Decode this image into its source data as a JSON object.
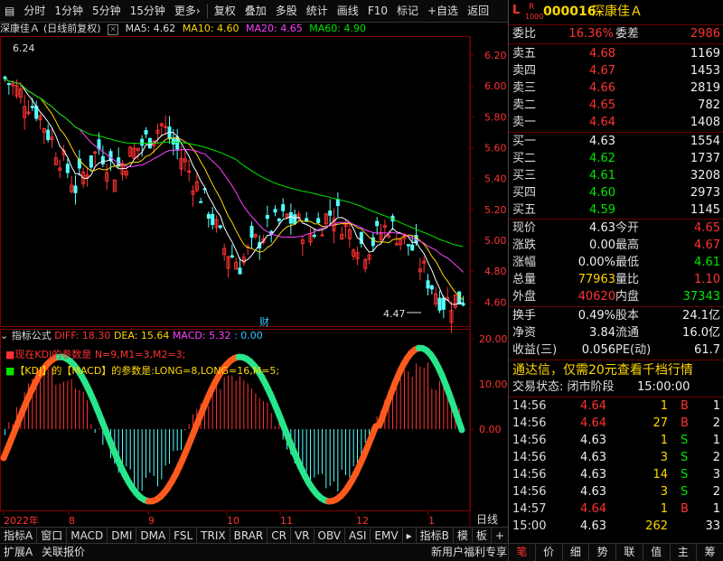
{
  "toolbar": {
    "items": [
      "分时",
      "1分钟",
      "5分钟",
      "15分钟",
      "更多›",
      "复权",
      "叠加",
      "多股",
      "统计",
      "画线",
      "F10",
      "标记",
      "+自选",
      "返回"
    ]
  },
  "chart": {
    "stock_title": "深康佳Ａ",
    "mode": "(日线前复权)",
    "ma5": "MA5: 4.62",
    "ma10": "MA10: 4.60",
    "ma20": "MA20: 4.65",
    "ma60": "MA60: 4.90",
    "high_label": "6.24",
    "low_label": "4.47",
    "cai_label": "财",
    "price_ticks": [
      "6.20",
      "6.00",
      "5.80",
      "5.60",
      "5.40",
      "5.20",
      "5.00",
      "4.80",
      "4.60"
    ],
    "indicator_title": "指标公式",
    "diff": "DIFF: 18.30",
    "dea": "DEA: 15.64",
    "macd": "MACD: 5.32",
    "macd_extra": ": 0.00",
    "line1": "现在KDJ的参数是 N=9,M1=3,M2=3;",
    "line2": "【KDJ】的【MACD】的参数是:LONG=8,LONG=16,M=5;",
    "ind_ticks": [
      "20.00",
      "10.00",
      "0.00"
    ],
    "dates": [
      "2022年",
      "8",
      "9",
      "10",
      "11",
      "12",
      "1"
    ],
    "period": "日线"
  },
  "chart_data": {
    "type": "candlestick",
    "title": "深康佳Ａ (日线前复权)",
    "ylim": [
      4.45,
      6.3
    ],
    "ma": {
      "MA5": 4.62,
      "MA10": 4.6,
      "MA20": 4.65,
      "MA60": 4.9
    },
    "high": 6.24,
    "low": 4.47,
    "indicator": {
      "DIFF": 18.3,
      "DEA": 15.64,
      "MACD": 5.32
    },
    "ind_ylim": [
      -18,
      22
    ]
  },
  "tabs": [
    "指标A",
    "窗口",
    "MACD",
    "DMI",
    "DMA",
    "FSL",
    "TRIX",
    "BRAR",
    "CR",
    "VR",
    "OBV",
    "ASI",
    "EMV",
    "指标B",
    "模",
    "板",
    "+",
    "-"
  ],
  "panel": {
    "code": "000016",
    "name": "深康佳Ａ",
    "logo_l": "L",
    "logo_r": "R",
    "logo_n": "1000",
    "weibi_label": "委比",
    "weibi": "16.36%",
    "weicha_label": "委差",
    "weicha": "2986",
    "sell": [
      {
        "label": "卖五",
        "price": "4.68",
        "vol": "1169"
      },
      {
        "label": "卖四",
        "price": "4.67",
        "vol": "1453"
      },
      {
        "label": "卖三",
        "price": "4.66",
        "vol": "2819"
      },
      {
        "label": "卖二",
        "price": "4.65",
        "vol": "782"
      },
      {
        "label": "卖一",
        "price": "4.64",
        "vol": "1408"
      }
    ],
    "buy": [
      {
        "label": "买一",
        "price": "4.63",
        "vol": "1554"
      },
      {
        "label": "买二",
        "price": "4.62",
        "vol": "1737"
      },
      {
        "label": "买三",
        "price": "4.61",
        "vol": "3208"
      },
      {
        "label": "买四",
        "price": "4.60",
        "vol": "2973"
      },
      {
        "label": "买五",
        "price": "4.59",
        "vol": "1145"
      }
    ],
    "stats": [
      {
        "l1": "现价",
        "v1": "4.63",
        "l2": "今开",
        "v2": "4.65"
      },
      {
        "l1": "涨跌",
        "v1": "0.00",
        "l2": "最高",
        "v2": "4.67"
      },
      {
        "l1": "涨幅",
        "v1": "0.00%",
        "l2": "最低",
        "v2": "4.61"
      },
      {
        "l1": "总量",
        "v1": "77963",
        "l2": "量比",
        "v2": "1.10"
      },
      {
        "l1": "外盘",
        "v1": "40620",
        "l2": "内盘",
        "v2": "37343"
      }
    ],
    "stats2": [
      {
        "l1": "换手",
        "v1": "0.49%",
        "l2": "股本",
        "v2": "24.1亿"
      },
      {
        "l1": "净资",
        "v1": "3.84",
        "l2": "流通",
        "v2": "16.0亿"
      },
      {
        "l1": "收益(三)",
        "v1": "0.056",
        "l2": "PE(动)",
        "v2": "61.7"
      }
    ],
    "promo": "通达信，仅需20元查看千档行情",
    "trade_state_label": "交易状态: 闭市阶段",
    "trade_state_time": "15:00:00",
    "ticks": [
      {
        "t": "14:56",
        "p": "4.64",
        "v": "1",
        "d": "B",
        "n": "1"
      },
      {
        "t": "14:56",
        "p": "4.64",
        "v": "27",
        "d": "B",
        "n": "2"
      },
      {
        "t": "14:56",
        "p": "4.63",
        "v": "1",
        "d": "S",
        "n": "1"
      },
      {
        "t": "14:56",
        "p": "4.63",
        "v": "3",
        "d": "S",
        "n": "2"
      },
      {
        "t": "14:56",
        "p": "4.63",
        "v": "14",
        "d": "S",
        "n": "3"
      },
      {
        "t": "14:56",
        "p": "4.63",
        "v": "3",
        "d": "S",
        "n": "2"
      },
      {
        "t": "14:57",
        "p": "4.64",
        "v": "1",
        "d": "B",
        "n": "1"
      },
      {
        "t": "15:00",
        "p": "4.63",
        "v": "262",
        "d": "",
        "n": "33"
      }
    ]
  },
  "status": {
    "left1": "扩展A",
    "left2": "关联报价",
    "right_promo": "新用户福利专享",
    "icons": [
      "笔",
      "价",
      "细",
      "势",
      "联",
      "值",
      "主",
      "筹"
    ]
  }
}
